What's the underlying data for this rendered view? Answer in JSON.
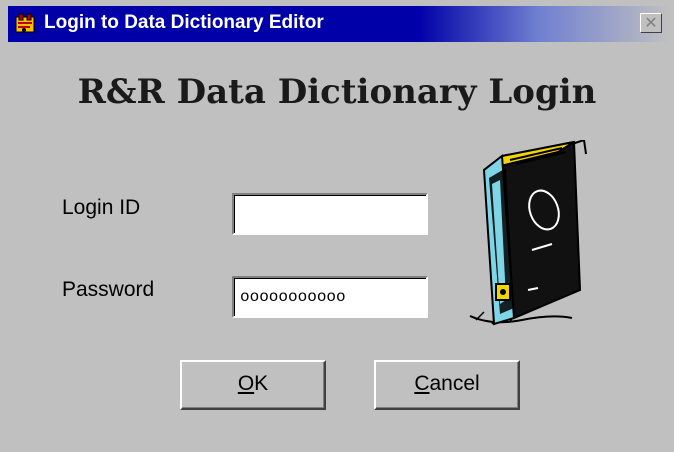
{
  "window": {
    "title": "Login to Data Dictionary Editor",
    "close_glyph": "✕"
  },
  "heading": "R&R Data Dictionary Login",
  "login_id": {
    "label": "Login ID",
    "value": ""
  },
  "password": {
    "label": "Password",
    "value": "ooooooooooo"
  },
  "buttons": {
    "ok": {
      "mnemonic": "O",
      "rest": "K"
    },
    "cancel": {
      "mnemonic": "C",
      "rest": "ancel"
    }
  },
  "colors": {
    "titlebar": "#0000a8",
    "face": "#c0c0c0",
    "field_bg": "#ffffff"
  },
  "icons": {
    "title": "app-icon",
    "illustration": "data-cartridge-icon"
  }
}
